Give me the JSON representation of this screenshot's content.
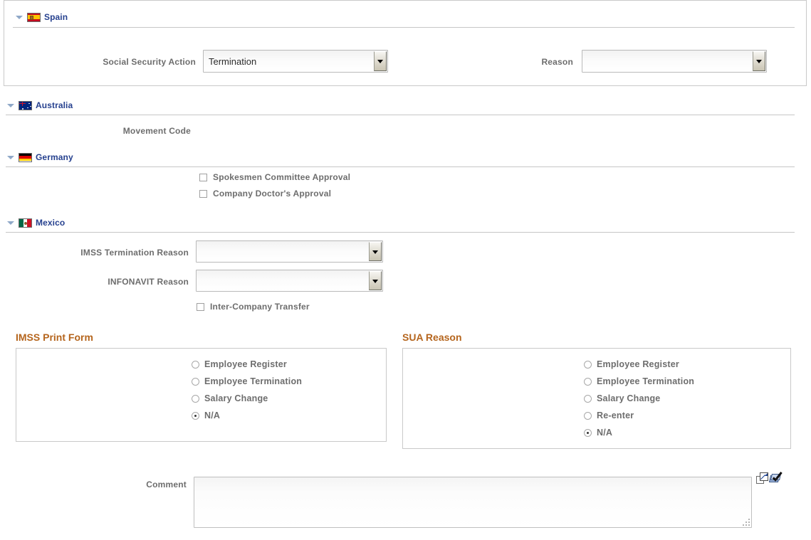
{
  "sections": {
    "spain": {
      "title": "Spain",
      "flag": "spain-flag-icon",
      "fields": {
        "social_security_action": {
          "label": "Social Security Action",
          "value": "Termination"
        },
        "reason": {
          "label": "Reason",
          "value": ""
        }
      }
    },
    "australia": {
      "title": "Australia",
      "flag": "australia-flag-icon",
      "fields": {
        "movement_code": {
          "label": "Movement Code",
          "value": ""
        }
      }
    },
    "germany": {
      "title": "Germany",
      "flag": "germany-flag-icon",
      "checkboxes": [
        {
          "label": "Spokesmen Committee Approval",
          "checked": false
        },
        {
          "label": "Company Doctor's Approval",
          "checked": false
        }
      ]
    },
    "mexico": {
      "title": "Mexico",
      "flag": "mexico-flag-icon",
      "fields": {
        "imss_termination_reason": {
          "label": "IMSS Termination Reason",
          "value": ""
        },
        "infonavit_reason": {
          "label": "INFONAVIT Reason",
          "value": ""
        }
      },
      "checkboxes": [
        {
          "label": "Inter-Company Transfer",
          "checked": false
        }
      ],
      "imss_print_form": {
        "title": "IMSS Print Form",
        "options": [
          {
            "label": "Employee Register",
            "selected": false
          },
          {
            "label": "Employee Termination",
            "selected": false
          },
          {
            "label": "Salary Change",
            "selected": false
          },
          {
            "label": "N/A",
            "selected": true
          }
        ]
      },
      "sua_reason": {
        "title": "SUA Reason",
        "options": [
          {
            "label": "Employee Register",
            "selected": false
          },
          {
            "label": "Employee Termination",
            "selected": false
          },
          {
            "label": "Salary Change",
            "selected": false
          },
          {
            "label": "Re-enter",
            "selected": false
          },
          {
            "label": "N/A",
            "selected": true
          }
        ]
      }
    },
    "comment": {
      "label": "Comment",
      "value": "",
      "icons": [
        {
          "name": "expand-icon"
        },
        {
          "name": "spell-check-icon"
        }
      ]
    }
  },
  "colors": {
    "section_title": "#26418f",
    "field_label": "#6d6d6d",
    "group_title": "#b5651d",
    "border": "#c9c9c9"
  }
}
